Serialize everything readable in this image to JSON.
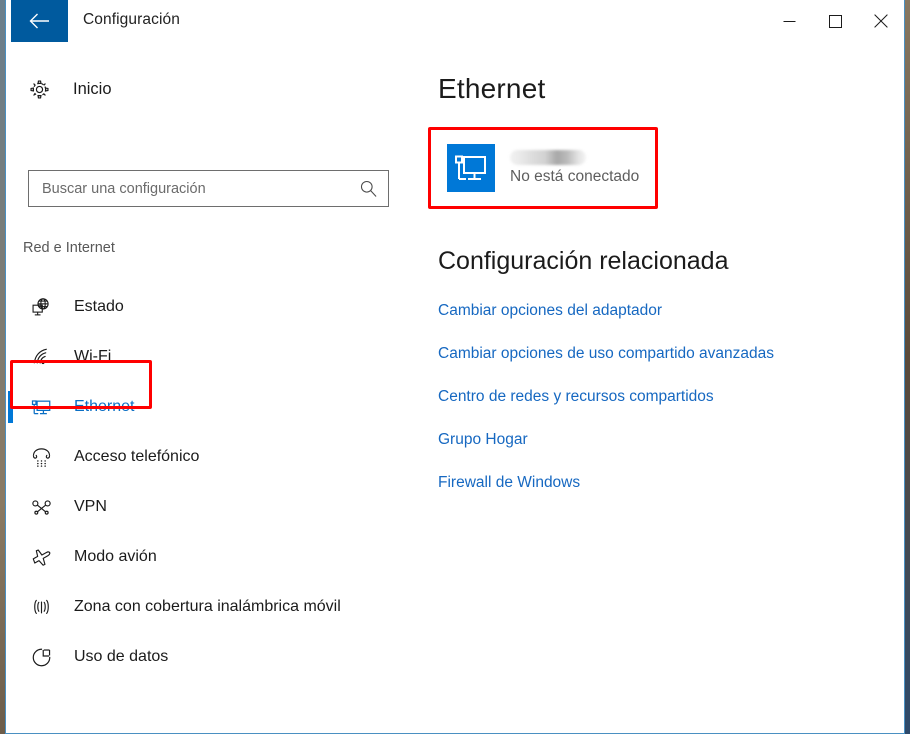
{
  "window": {
    "title": "Configuración",
    "back_icon": "back-arrow-icon",
    "controls": {
      "minimize": "minimize-icon",
      "maximize": "maximize-icon",
      "close": "close-icon"
    },
    "accent_color": "#0078D7",
    "titlebar_button_color": "#005A9E"
  },
  "sidebar": {
    "home": {
      "label": "Inicio",
      "icon": "gear-icon"
    },
    "search": {
      "placeholder": "Buscar una configuración",
      "value": "",
      "icon": "search-icon"
    },
    "section_label": "Red e Internet",
    "items": [
      {
        "label": "Estado",
        "icon": "globe-monitor-icon",
        "selected": false
      },
      {
        "label": "Wi-Fi",
        "icon": "wifi-icon",
        "selected": false
      },
      {
        "label": "Ethernet",
        "icon": "ethernet-monitor-icon",
        "selected": true
      },
      {
        "label": "Acceso telefónico",
        "icon": "dialup-phone-icon",
        "selected": false
      },
      {
        "label": "VPN",
        "icon": "vpn-key-icon",
        "selected": false
      },
      {
        "label": "Modo avión",
        "icon": "airplane-icon",
        "selected": false
      },
      {
        "label": "Zona con cobertura inalámbrica móvil",
        "icon": "hotspot-icon",
        "selected": false
      },
      {
        "label": "Uso de datos",
        "icon": "data-usage-pie-icon",
        "selected": false
      }
    ]
  },
  "content": {
    "page_title": "Ethernet",
    "ethernet_card": {
      "icon": "ethernet-adapter-icon",
      "adapter_name_redacted": true,
      "status": "No está conectado"
    },
    "related": {
      "title": "Configuración relacionada",
      "links": [
        {
          "label": "Cambiar opciones del adaptador"
        },
        {
          "label": "Cambiar opciones de uso compartido avanzadas"
        },
        {
          "label": "Centro de redes y recursos compartidos"
        },
        {
          "label": "Grupo Hogar"
        },
        {
          "label": "Firewall de Windows"
        }
      ],
      "link_color": "#1668C1"
    }
  },
  "annotations": {
    "color": "#FF0000",
    "boxes": [
      {
        "target": "ethernet-status-card"
      },
      {
        "target": "sidebar-item-ethernet"
      }
    ]
  }
}
